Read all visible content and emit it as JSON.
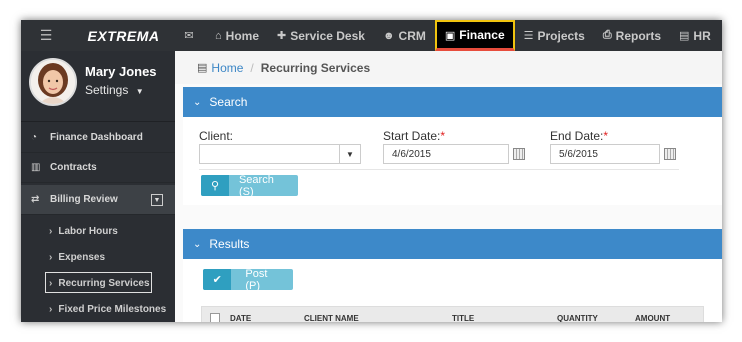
{
  "topbar": {
    "logo": "EXTREMA",
    "nav": [
      {
        "label": "",
        "icon": "mail-icon"
      },
      {
        "label": "Home",
        "icon": "home-icon"
      },
      {
        "label": "Service Desk",
        "icon": "wrench-icon"
      },
      {
        "label": "CRM",
        "icon": "users-icon"
      },
      {
        "label": "Finance",
        "icon": "money-icon",
        "active": true
      },
      {
        "label": "Projects",
        "icon": "list-icon"
      },
      {
        "label": "Reports",
        "icon": "print-icon"
      },
      {
        "label": "HR",
        "icon": "briefcase-icon"
      }
    ]
  },
  "user": {
    "name": "Mary Jones",
    "settings_label": "Settings"
  },
  "sidebar": {
    "items": [
      {
        "label": "Finance Dashboard"
      },
      {
        "label": "Contracts"
      },
      {
        "label": "Billing Review"
      }
    ],
    "sub_items": [
      {
        "label": "Labor Hours"
      },
      {
        "label": "Expenses"
      },
      {
        "label": "Recurring Services",
        "selected": true
      },
      {
        "label": "Fixed Price Milestones"
      }
    ]
  },
  "breadcrumb": {
    "home": "Home",
    "current": "Recurring Services"
  },
  "search": {
    "title": "Search",
    "client_label": "Client:",
    "client_value": "",
    "start_label": "Start Date:",
    "start_value": "4/6/2015",
    "end_label": "End Date:",
    "end_value": "5/6/2015",
    "required_mark": "*",
    "button_label": "Search (S)"
  },
  "results": {
    "title": "Results",
    "post_label": "Post (P)",
    "columns": [
      "DATE",
      "CLIENT NAME",
      "TITLE",
      "QUANTITY",
      "AMOUNT"
    ]
  },
  "colors": {
    "accent": "#3d89c9",
    "active_border": "#f1c40f",
    "active_underline": "#e74c3c",
    "button": "#74c3d9"
  }
}
